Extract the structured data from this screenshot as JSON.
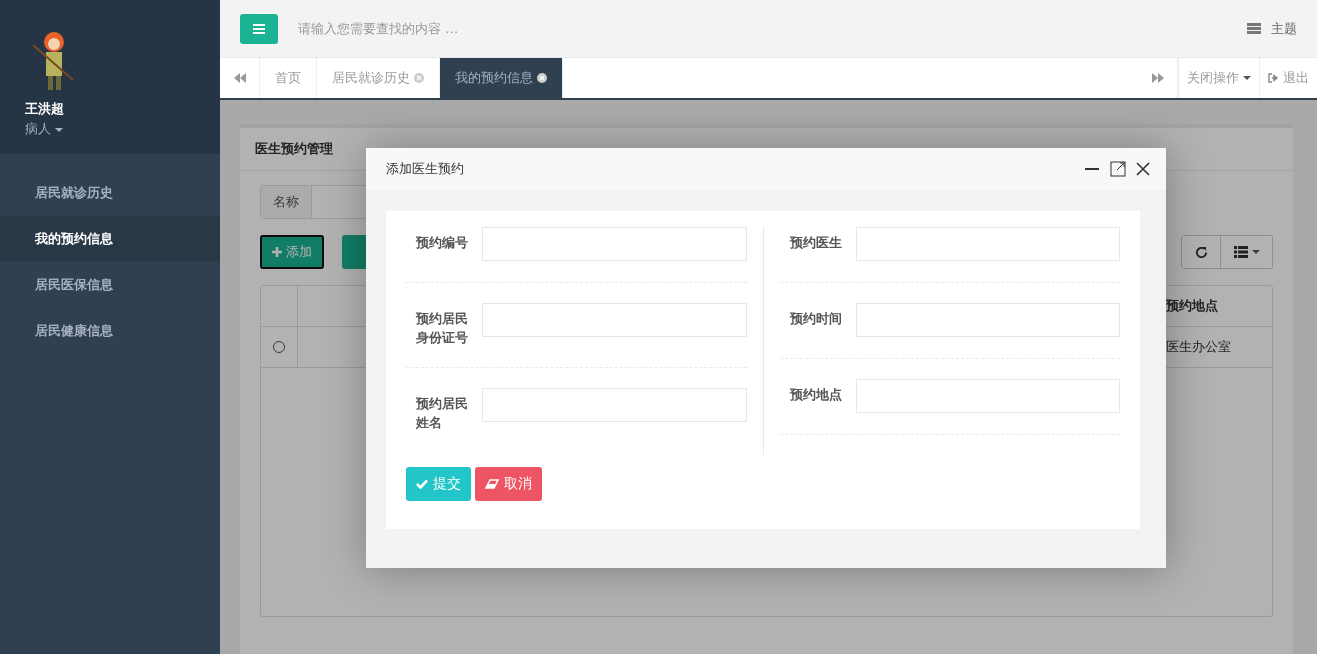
{
  "user": {
    "name": "王洪超",
    "role": "病人"
  },
  "sidebar": {
    "items": [
      {
        "label": "居民就诊历史",
        "selected": false
      },
      {
        "label": "我的预约信息",
        "selected": true
      },
      {
        "label": "居民医保信息",
        "selected": false
      },
      {
        "label": "居民健康信息",
        "selected": false
      }
    ]
  },
  "topbar": {
    "search": {
      "placeholder": "请输入您需要查找的内容 …"
    },
    "theme_label": "主题"
  },
  "tabs": [
    {
      "label": "首页",
      "selected": false,
      "closable": false
    },
    {
      "label": "居民就诊历史",
      "selected": false,
      "closable": true
    },
    {
      "label": "我的预约信息",
      "selected": true,
      "closable": true
    }
  ],
  "tab_actions": {
    "close_menu": "关闭操作",
    "logout": "退出"
  },
  "panel": {
    "title": "医生预约管理",
    "filter_label": "名称",
    "add_button": "添加",
    "table": {
      "columns": [
        "预约地点"
      ],
      "rows": [
        {
          "selected": false,
          "cells": [
            "医生办公室"
          ]
        }
      ]
    }
  },
  "dialog": {
    "title": "添加医生预约",
    "left_fields": [
      {
        "label": "预约编号"
      },
      {
        "label": "预约居民身份证号"
      },
      {
        "label": "预约居民姓名"
      }
    ],
    "right_fields": [
      {
        "label": "预约医生"
      },
      {
        "label": "预约时间"
      },
      {
        "label": "预约地点"
      }
    ],
    "submit": "提交",
    "cancel": "取消"
  }
}
